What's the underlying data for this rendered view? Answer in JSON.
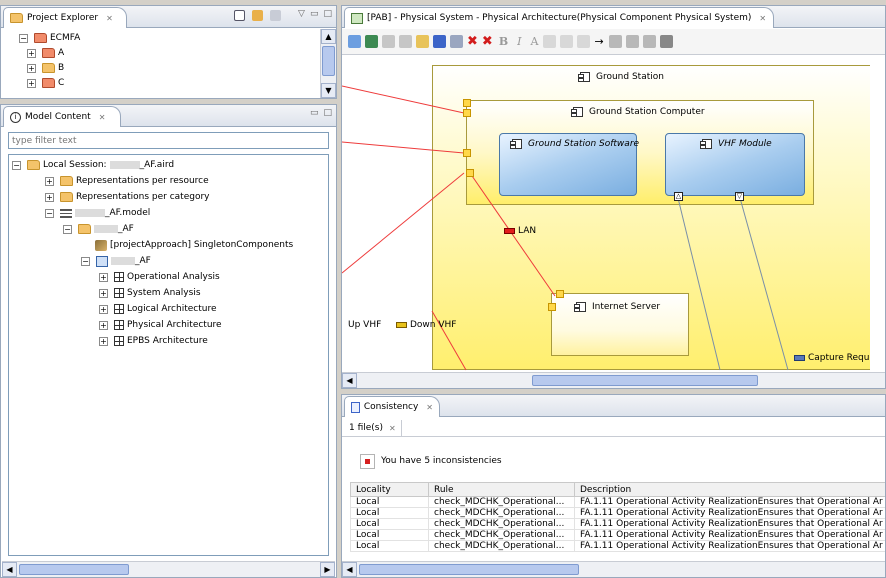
{
  "project_explorer": {
    "tab_label": "Project Explorer",
    "tree": [
      {
        "label": "ECMFA",
        "expanded": true
      },
      {
        "label": "A"
      },
      {
        "label": "B"
      },
      {
        "label": "C"
      }
    ]
  },
  "model_content": {
    "tab_label": "Model Content",
    "filter_placeholder": "type filter text",
    "tree": [
      {
        "label": "Local Session:",
        "suffix": "_AF.aird"
      },
      {
        "label": "Representations per resource"
      },
      {
        "label": "Representations per category"
      },
      {
        "label": "_AF.model"
      },
      {
        "label": "_AF"
      },
      {
        "label": "[projectApproach] SingletonComponents"
      },
      {
        "label": "_AF"
      },
      {
        "label": "Operational Analysis"
      },
      {
        "label": "System Analysis"
      },
      {
        "label": "Logical Architecture"
      },
      {
        "label": "Physical Architecture"
      },
      {
        "label": "EPBS Architecture"
      }
    ]
  },
  "editor": {
    "tab_label": "[PAB] - Physical System - Physical Architecture(Physical Component Physical System)",
    "toolbar_text": {
      "bold": "B",
      "italic": "I",
      "font": "A"
    },
    "diagram": {
      "ground_station": "Ground Station",
      "ground_station_computer": "Ground Station Computer",
      "ground_station_software": "Ground Station Software",
      "vhf_module": "VHF Module",
      "lan": "LAN",
      "internet_server": "Internet Server",
      "up_vhf": "Up VHF",
      "down_vhf": "Down VHF",
      "capture_requests": "Capture Reques"
    }
  },
  "consistency": {
    "tab_label": "Consistency",
    "subtab_label": "1 file(s)",
    "message": "You have 5 inconsistencies",
    "columns": [
      "Locality",
      "Rule",
      "Description"
    ],
    "rows": [
      [
        "Local",
        "check_MDCHK_Operational...",
        "FA.1.11 Operational Activity RealizationEnsures that Operational Ar"
      ],
      [
        "Local",
        "check_MDCHK_Operational...",
        "FA.1.11 Operational Activity RealizationEnsures that Operational Ar"
      ],
      [
        "Local",
        "check_MDCHK_Operational...",
        "FA.1.11 Operational Activity RealizationEnsures that Operational Ar"
      ],
      [
        "Local",
        "check_MDCHK_Operational...",
        "FA.1.11 Operational Activity RealizationEnsures that Operational Ar"
      ],
      [
        "Local",
        "check_MDCHK_Operational...",
        "FA.1.11 Operational Activity RealizationEnsures that Operational Ar"
      ]
    ]
  },
  "colors": {
    "accent": "#99a8bc",
    "diagram_yellow": "#ffef6e",
    "component_blue": "#7aaee0",
    "link_red": "#ee3b3b",
    "error_red": "#d61f1f"
  }
}
